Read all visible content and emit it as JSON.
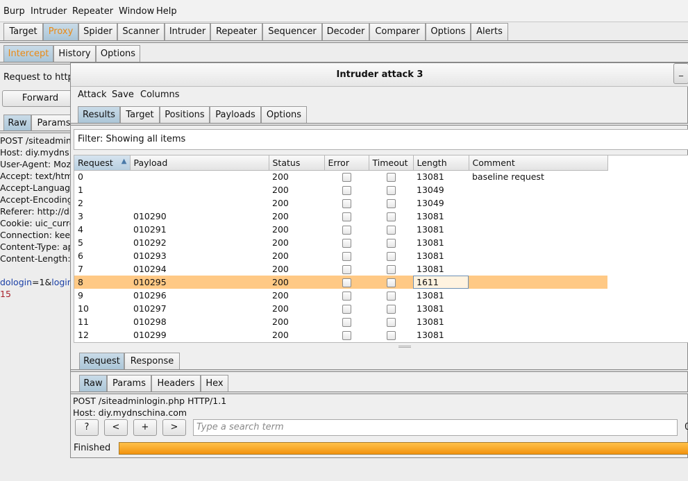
{
  "menu": [
    "Burp",
    "Intruder",
    "Repeater",
    "Window",
    "Help"
  ],
  "main_tabs": [
    "Target",
    "Proxy",
    "Spider",
    "Scanner",
    "Intruder",
    "Repeater",
    "Sequencer",
    "Decoder",
    "Comparer",
    "Options",
    "Alerts"
  ],
  "proxy_tabs": [
    "Intercept",
    "History",
    "Options"
  ],
  "background": {
    "request_to": "Request to http",
    "forward_label": "Forward",
    "editor_tabs": [
      "Raw",
      "Params"
    ],
    "raw_lines": [
      "POST /siteadmin",
      "Host: diy.mydns",
      "User-Agent: Moz",
      "Accept: text/htm",
      "Accept-Languag",
      "Accept-Encoding",
      "Referer: http://di",
      "Cookie: uic_curre",
      "Connection: kee",
      "Content-Type: ap",
      "Content-Length:"
    ],
    "body_line_a": "dologin",
    "body_line_b": "=1&",
    "body_line_c": "login",
    "body_line_2": "15"
  },
  "dialog": {
    "title": "Intruder attack 3",
    "minimize": "_",
    "menu": [
      "Attack",
      "Save",
      "Columns"
    ],
    "tabs": [
      "Results",
      "Target",
      "Positions",
      "Payloads",
      "Options"
    ],
    "filter_text": "Filter: Showing all items",
    "columns": [
      "Request",
      "Payload",
      "Status",
      "Error",
      "Timeout",
      "Length",
      "Comment"
    ],
    "sort_indicator": "▲",
    "rows": [
      {
        "request": "0",
        "payload": "",
        "status": "200",
        "length": "13081",
        "comment": "baseline request"
      },
      {
        "request": "1",
        "payload": "",
        "status": "200",
        "length": "13049",
        "comment": ""
      },
      {
        "request": "2",
        "payload": "",
        "status": "200",
        "length": "13049",
        "comment": ""
      },
      {
        "request": "3",
        "payload": "010290",
        "status": "200",
        "length": "13081",
        "comment": ""
      },
      {
        "request": "4",
        "payload": "010291",
        "status": "200",
        "length": "13081",
        "comment": ""
      },
      {
        "request": "5",
        "payload": "010292",
        "status": "200",
        "length": "13081",
        "comment": ""
      },
      {
        "request": "6",
        "payload": "010293",
        "status": "200",
        "length": "13081",
        "comment": ""
      },
      {
        "request": "7",
        "payload": "010294",
        "status": "200",
        "length": "13081",
        "comment": ""
      },
      {
        "request": "8",
        "payload": "010295",
        "status": "200",
        "length": "1611",
        "comment": "",
        "selected": true
      },
      {
        "request": "9",
        "payload": "010296",
        "status": "200",
        "length": "13081",
        "comment": ""
      },
      {
        "request": "10",
        "payload": "010297",
        "status": "200",
        "length": "13081",
        "comment": ""
      },
      {
        "request": "11",
        "payload": "010298",
        "status": "200",
        "length": "13081",
        "comment": ""
      },
      {
        "request": "12",
        "payload": "010299",
        "status": "200",
        "length": "13081",
        "comment": ""
      }
    ],
    "detail_tabs": [
      "Request",
      "Response"
    ],
    "editor_tabs": [
      "Raw",
      "Params",
      "Headers",
      "Hex"
    ],
    "request_lines": [
      "POST /siteadminlogin.php HTTP/1.1",
      "Host: diy.mydnschina.com"
    ],
    "nav_buttons": [
      "?",
      "<",
      "+",
      ">"
    ],
    "search_placeholder": "Type a search term",
    "search_count": "0",
    "status": "Finished",
    "progress": 1.0
  },
  "colors": {
    "accent_orange": "#e98a15",
    "selected_row": "#ffc985",
    "active_tab": "#b3cde0",
    "progress": "#f5a020"
  }
}
